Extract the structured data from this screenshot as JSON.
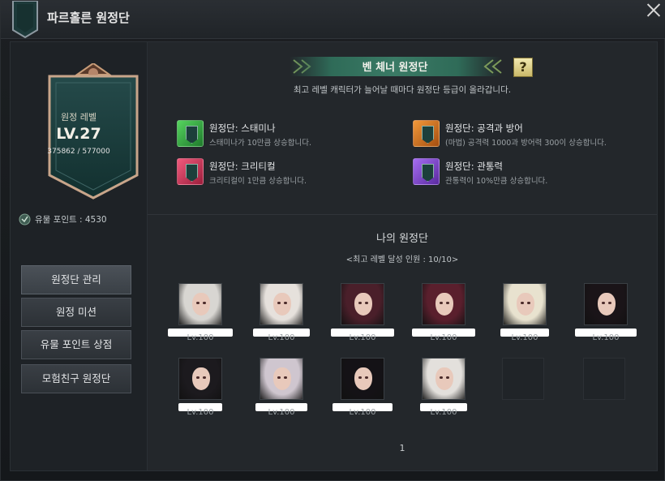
{
  "window": {
    "title": "파르홀른 원정단"
  },
  "sidebar": {
    "banner": {
      "title": "원정 레벨",
      "level": "LV.27",
      "exp": "375862 / 577000"
    },
    "relic_points": "유물 포인트 : 4530",
    "buttons": [
      {
        "label": "원정단 관리"
      },
      {
        "label": "원정 미션"
      },
      {
        "label": "유물 포인트 상점"
      },
      {
        "label": "모험친구 원정단"
      }
    ]
  },
  "header": {
    "title": "벤 체너 원정단",
    "help": "?",
    "description": "최고 레벨 캐릭터가 늘어날 때마다 원정단 등급이 올라갑니다."
  },
  "buffs": [
    {
      "title": "원정단: 스태미나",
      "desc": "스태미나가 10만큼 상승합니다.",
      "color": "#37b34a"
    },
    {
      "title": "원정단: 공격과 방어",
      "desc": "(마법) 공격력 1000과 방어력 300이 상승합니다.",
      "color": "#d8741f"
    },
    {
      "title": "원정단: 크리티컬",
      "desc": "크리티컬이 1만큼 상승합니다.",
      "color": "#d83a5e"
    },
    {
      "title": "원정단: 관통력",
      "desc": "관통력이 10%만큼 상승합니다.",
      "color": "#8a4ad0"
    }
  ],
  "my_expedition": {
    "title": "나의 원정단",
    "subtitle": "<최고 레벨 달성 인원 : 10/10>",
    "characters": [
      {
        "level": "Lv.100",
        "hair": "#d8d6d2"
      },
      {
        "level": "Lv.100",
        "hair": "#e6e1dc"
      },
      {
        "level": "Lv.100",
        "hair": "#4a1f2a"
      },
      {
        "level": "Lv.100",
        "hair": "#5a1f2d"
      },
      {
        "level": "Lv.100",
        "hair": "#e8e2cf"
      },
      {
        "level": "Lv.100",
        "hair": "#1a1418"
      },
      {
        "level": "Lv.100",
        "hair": "#1c1a1e"
      },
      {
        "level": "Lv.100",
        "hair": "#cfc6cf"
      },
      {
        "level": "Lv.100",
        "hair": "#141216"
      },
      {
        "level": "Lv.100",
        "hair": "#e3e0dc"
      }
    ],
    "page": "1"
  }
}
